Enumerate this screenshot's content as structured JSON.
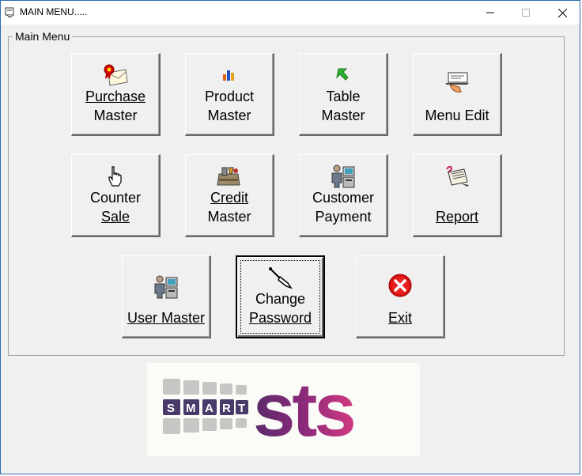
{
  "window": {
    "title": "MAIN MENU.....",
    "minimize_glyph": "—",
    "maximize_glyph": "☐",
    "close_glyph": "✕"
  },
  "group": {
    "label": "Main Menu"
  },
  "buttons": {
    "purchase_master": {
      "line1": "Purchase",
      "line2": "Master",
      "icon": "certificate-icon"
    },
    "product_master": {
      "line1": "Product",
      "line2": "Master",
      "icon": "bar-chart-icon"
    },
    "table_master": {
      "line1": "Table",
      "line2": "Master",
      "icon": "green-arrow-icon"
    },
    "menu_edit": {
      "line1": "",
      "line2": "Menu Edit",
      "icon": "serving-tray-icon"
    },
    "counter_sale": {
      "line1": "Counter",
      "line2": "Sale",
      "icon": "hand-pointer-icon"
    },
    "credit_master": {
      "line1": "Credit",
      "line2": "Master",
      "icon": "toolbox-icon"
    },
    "customer_payment": {
      "line1": "Customer",
      "line2": "Payment",
      "icon": "person-computer-icon"
    },
    "report": {
      "line1": "",
      "line2": "Report",
      "icon": "report-pad-icon"
    },
    "user_master": {
      "line1": "",
      "line2": "User Master",
      "icon": "person-computer-icon"
    },
    "change_password": {
      "line1": "Change",
      "line2": "Password",
      "icon": "key-icon"
    },
    "exit": {
      "line1": "",
      "line2": "Exit",
      "icon": "red-x-icon"
    }
  },
  "logo": {
    "left_text": "SMART",
    "main_text": "sts",
    "left_color": "#4a3a6a",
    "main_color": "#8b2d7a"
  }
}
